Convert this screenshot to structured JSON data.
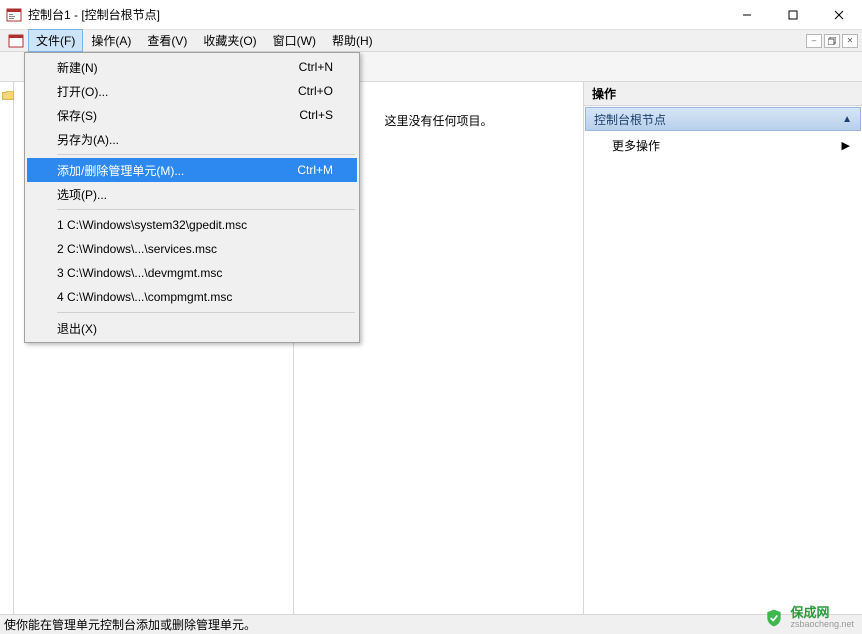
{
  "window": {
    "title": "控制台1 - [控制台根节点]"
  },
  "menubar": {
    "items": [
      "文件(F)",
      "操作(A)",
      "查看(V)",
      "收藏夹(O)",
      "窗口(W)",
      "帮助(H)"
    ]
  },
  "dropdown": {
    "g1": [
      {
        "label": "新建(N)",
        "shortcut": "Ctrl+N"
      },
      {
        "label": "打开(O)...",
        "shortcut": "Ctrl+O"
      },
      {
        "label": "保存(S)",
        "shortcut": "Ctrl+S"
      },
      {
        "label": "另存为(A)...",
        "shortcut": ""
      }
    ],
    "g2": [
      {
        "label": "添加/删除管理单元(M)...",
        "shortcut": "Ctrl+M",
        "highlight": true
      },
      {
        "label": "选项(P)...",
        "shortcut": ""
      }
    ],
    "g3": [
      {
        "label": "1 C:\\Windows\\system32\\gpedit.msc",
        "shortcut": ""
      },
      {
        "label": "2 C:\\Windows\\...\\services.msc",
        "shortcut": ""
      },
      {
        "label": "3 C:\\Windows\\...\\devmgmt.msc",
        "shortcut": ""
      },
      {
        "label": "4 C:\\Windows\\...\\compmgmt.msc",
        "shortcut": ""
      }
    ],
    "g4": [
      {
        "label": "退出(X)",
        "shortcut": ""
      }
    ]
  },
  "center": {
    "empty": "这里没有任何项目。"
  },
  "right": {
    "header": "操作",
    "section": "控制台根节点",
    "action": "更多操作"
  },
  "statusbar": {
    "text": "使你能在管理单元控制台添加或删除管理单元。"
  },
  "watermark": {
    "main": "保成网",
    "sub": "zsbaocheng.net"
  }
}
